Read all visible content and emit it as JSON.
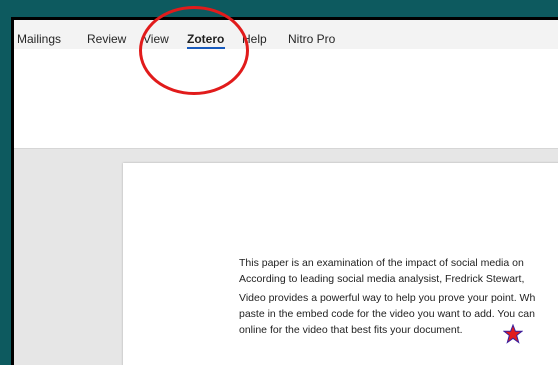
{
  "ribbon": {
    "tabs": [
      {
        "label": "Mailings"
      },
      {
        "label": "Review"
      },
      {
        "label": "View"
      },
      {
        "label": "Zotero"
      },
      {
        "label": "Help"
      },
      {
        "label": "Nitro Pro"
      }
    ],
    "active_tab": "Zotero"
  },
  "document": {
    "paragraph1": {
      "line1": "This paper is an examination of the impact of social media on",
      "line2": "According to leading social media analysist, Fredrick Stewart,"
    },
    "paragraph2": {
      "line1": "Video provides a powerful way to help you prove your point. Wh",
      "line2": "paste in the embed code for the video you want to add. You can",
      "line3": "online for the video that best fits your document."
    }
  },
  "annotations": {
    "highlight_color": "#e11b1b",
    "circle_target": "Zotero",
    "star_icon": "star-icon"
  },
  "colors": {
    "desktop": "#0d5a5f",
    "accent": "#185abd"
  }
}
